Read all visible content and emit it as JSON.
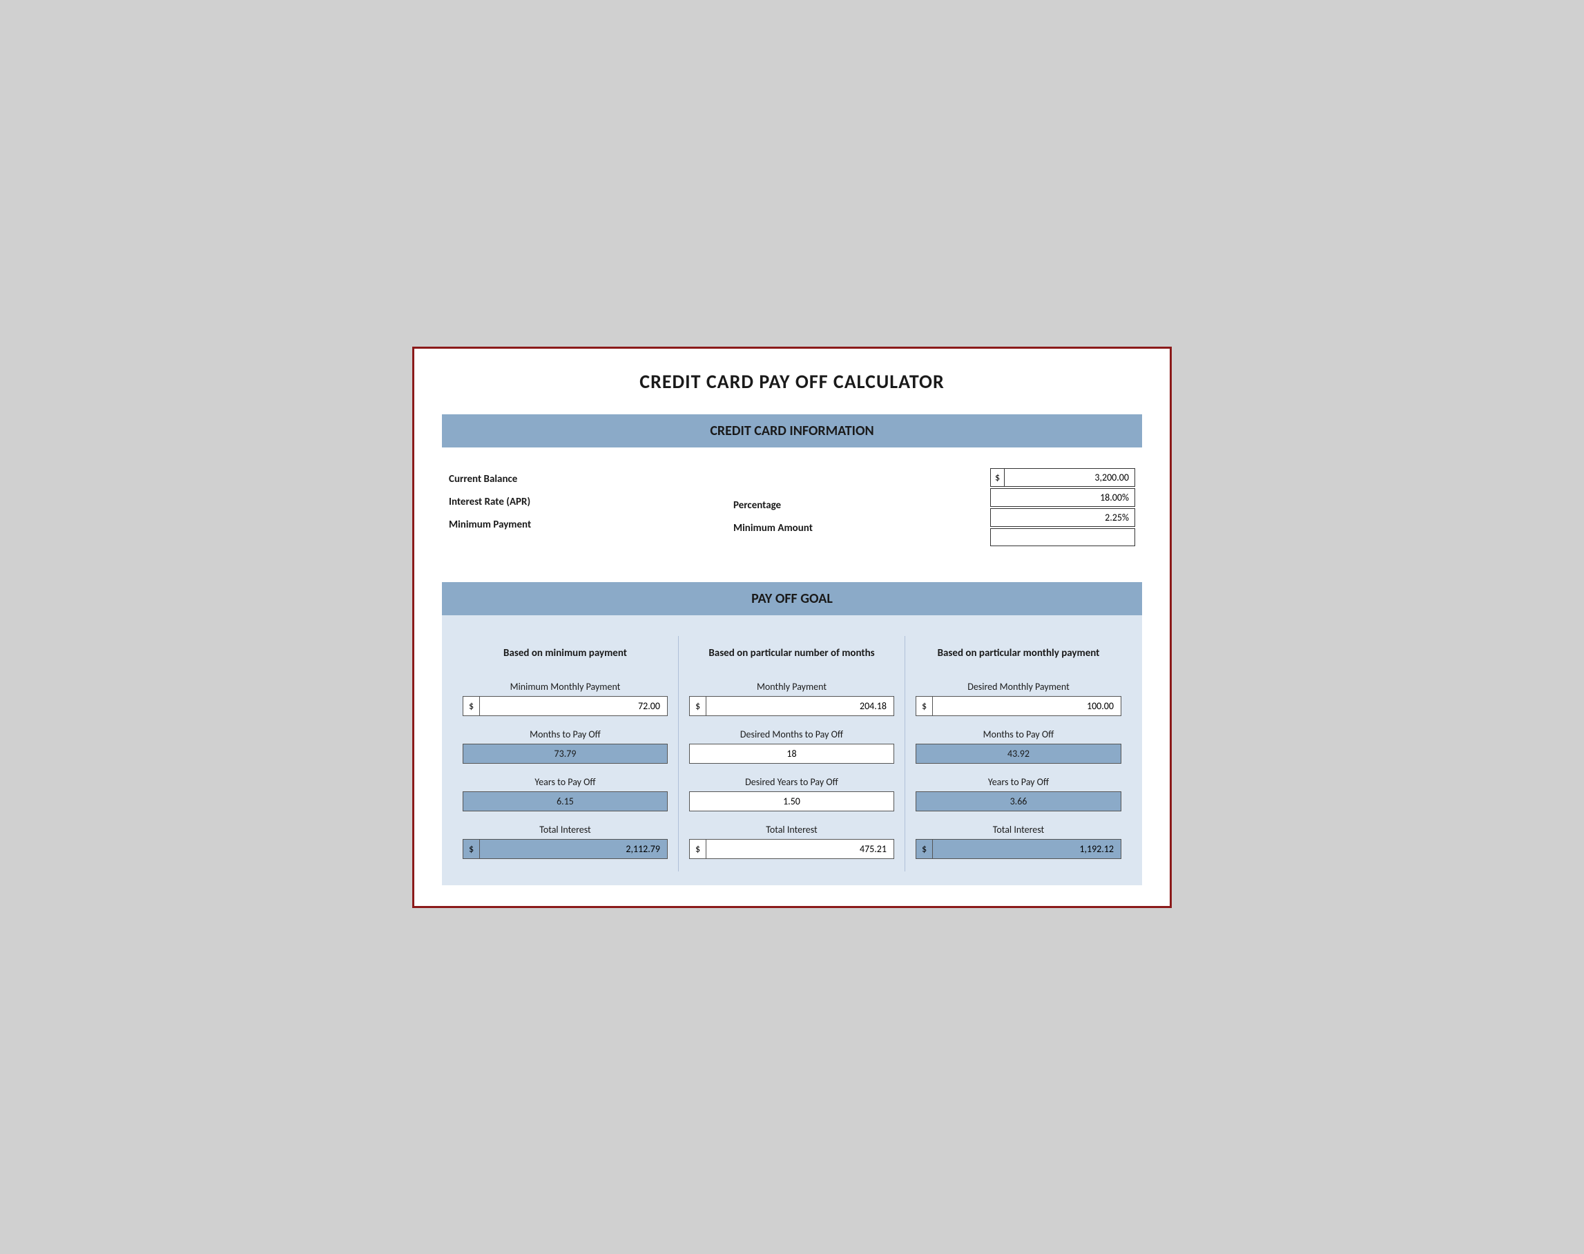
{
  "page": {
    "title": "CREDIT CARD PAY OFF CALCULATOR"
  },
  "cc_info": {
    "header": "CREDIT CARD INFORMATION",
    "labels": {
      "current_balance": "Current Balance",
      "interest_rate": "Interest Rate (APR)",
      "minimum_payment": "Minimum Payment"
    },
    "sublabels": {
      "percentage": "Percentage",
      "minimum_amount": "Minimum Amount"
    },
    "values": {
      "dollar_sign": "$",
      "current_balance": "3,200.00",
      "interest_rate": "18.00%",
      "min_payment_pct": "2.25%",
      "min_amount": ""
    }
  },
  "payoff": {
    "header": "PAY OFF GOAL",
    "col1": {
      "header": "Based on minimum payment",
      "monthly_label": "Minimum Monthly Payment",
      "monthly_dollar": "$",
      "monthly_value": "72.00",
      "months_label": "Months to Pay Off",
      "months_value": "73.79",
      "years_label": "Years to Pay Off",
      "years_value": "6.15",
      "interest_label": "Total Interest",
      "interest_dollar": "$",
      "interest_value": "2,112.79"
    },
    "col2": {
      "header": "Based on particular number of months",
      "monthly_label": "Monthly Payment",
      "monthly_dollar": "$",
      "monthly_value": "204.18",
      "months_label": "Desired Months to Pay Off",
      "months_value": "18",
      "years_label": "Desired Years to Pay Off",
      "years_value": "1.50",
      "interest_label": "Total Interest",
      "interest_dollar": "$",
      "interest_value": "475.21"
    },
    "col3": {
      "header": "Based on particular monthly payment",
      "monthly_label": "Desired Monthly Payment",
      "monthly_dollar": "$",
      "monthly_value": "100.00",
      "months_label": "Months to Pay Off",
      "months_value": "43.92",
      "years_label": "Years to Pay Off",
      "years_value": "3.66",
      "interest_label": "Total Interest",
      "interest_dollar": "$",
      "interest_value": "1,192.12"
    }
  }
}
